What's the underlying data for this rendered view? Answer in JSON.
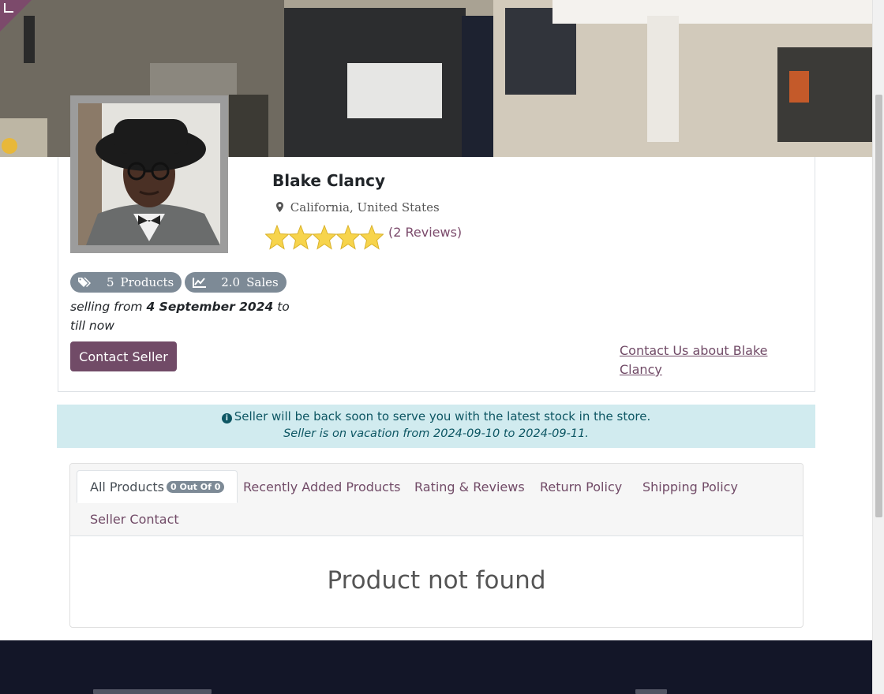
{
  "seller": {
    "name": "Blake Clancy",
    "location": "California, United States",
    "rating_stars": 5,
    "reviews_label": "(2 Reviews)",
    "products_count": "5",
    "products_label": "Products",
    "sales_count": "2.0",
    "sales_label": "Sales",
    "selling_prefix": "selling from ",
    "selling_date": "4 September 2024",
    "selling_suffix": " to till now",
    "contact_button": "Contact Seller",
    "contact_us_link": "Contact Us about Blake Clancy"
  },
  "alert": {
    "line1": "Seller will be back soon to serve you with the latest stock in the store.",
    "line2": "Seller is on vacation from 2024-09-10 to 2024-09-11."
  },
  "tabs": {
    "all_products": "All Products",
    "all_products_count": "0 Out Of 0",
    "recently_added": "Recently Added Products",
    "rating_reviews": "Rating & Reviews",
    "return_policy": "Return Policy",
    "shipping_policy": "Shipping Policy",
    "seller_contact": "Seller Contact"
  },
  "content": {
    "empty_message": "Product not found"
  },
  "icons": {
    "location": "map-marker-icon",
    "products": "tags-icon",
    "sales": "line-chart-icon",
    "info": "info-circle-icon",
    "star": "star-icon"
  },
  "colors": {
    "brand": "#714b67",
    "badge": "#7d8a96",
    "alert_bg": "#d1ebef",
    "alert_text": "#0d5663",
    "star": "#f7d44c",
    "footer": "#131628"
  }
}
